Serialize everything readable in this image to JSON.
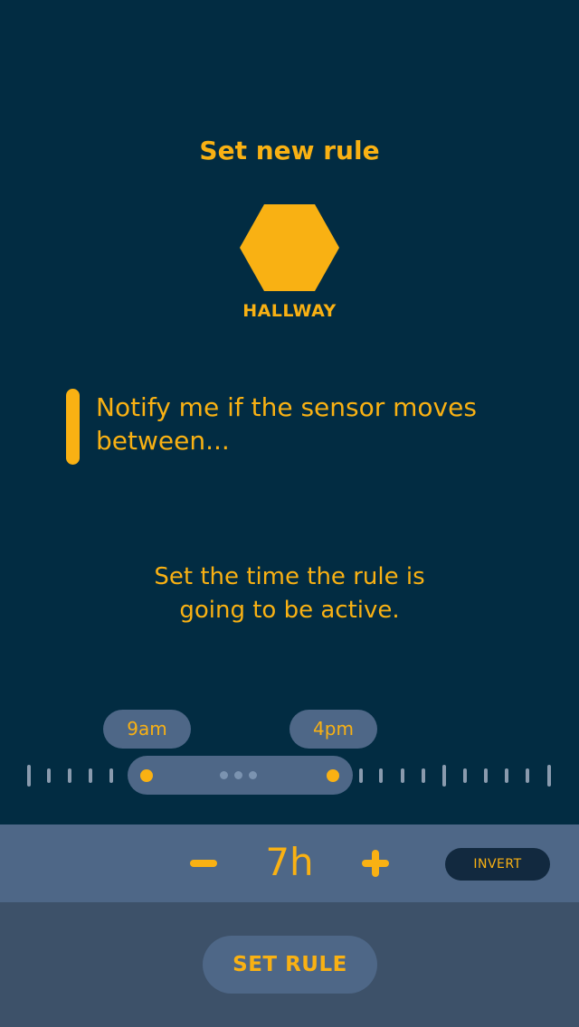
{
  "header": {
    "title": "Set new rule"
  },
  "sensor": {
    "icon": "hexagon-icon",
    "name": "HALLWAY",
    "color": "#F9B113"
  },
  "rule": {
    "text": "Notify me if the sensor moves between..."
  },
  "hint": {
    "line1": "Set the time the rule is",
    "line2": "going to be active."
  },
  "time_range": {
    "start": "9am",
    "end": "4pm"
  },
  "controls": {
    "decrement_icon": "minus-icon",
    "duration": "7h",
    "increment_icon": "plus-icon",
    "invert_label": "INVERT"
  },
  "footer": {
    "set_rule_label": "SET RULE"
  },
  "colors": {
    "background": "#022C42",
    "accent": "#F9B113",
    "control_bar": "#4E6787",
    "footer": "#3D5169"
  }
}
